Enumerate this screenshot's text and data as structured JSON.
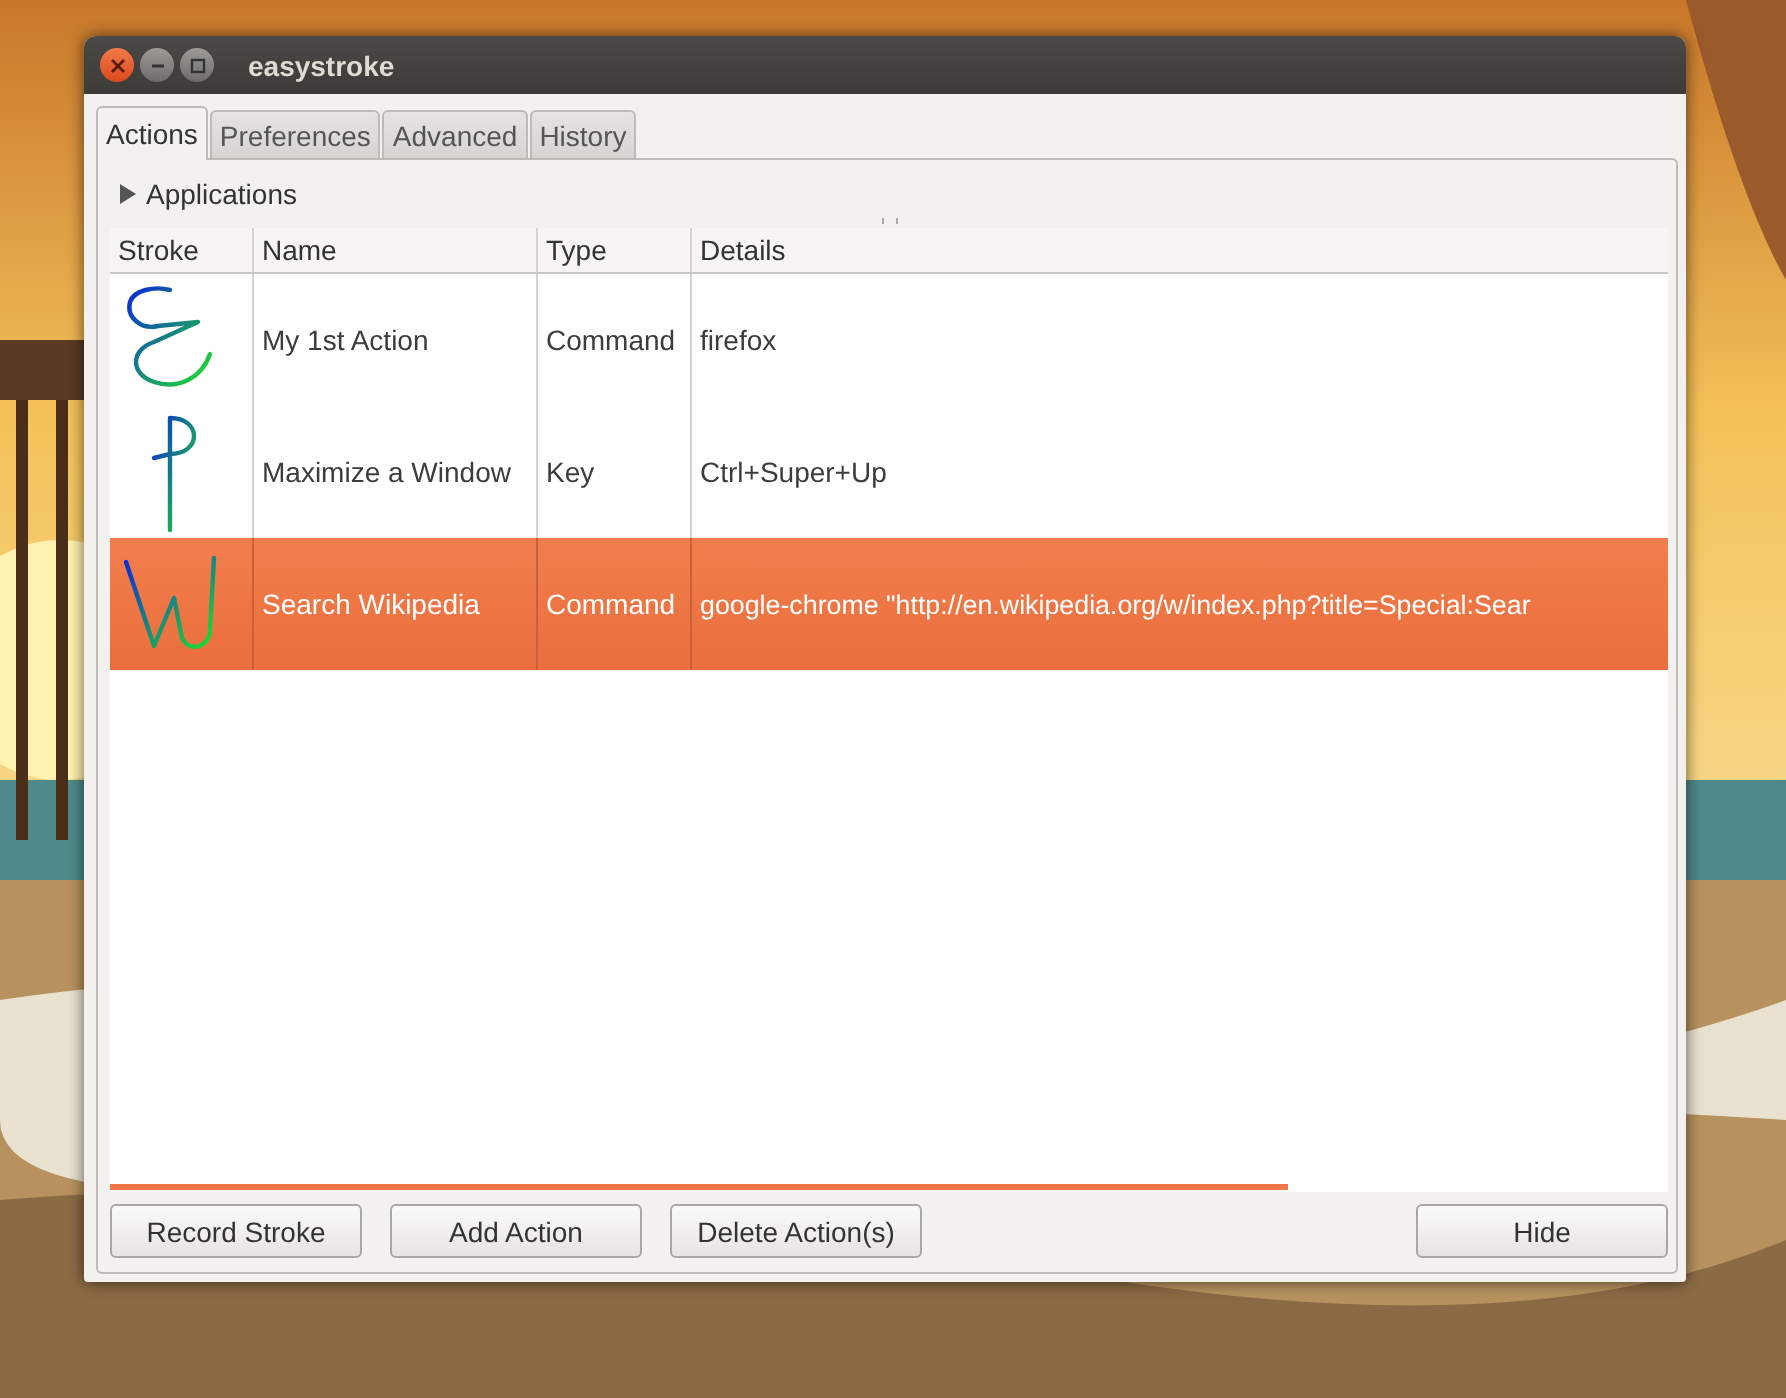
{
  "window": {
    "title": "easystroke"
  },
  "tabs": [
    {
      "label": "Actions",
      "selected": true
    },
    {
      "label": "Preferences",
      "selected": false
    },
    {
      "label": "Advanced",
      "selected": false
    },
    {
      "label": "History",
      "selected": false
    }
  ],
  "expander": {
    "label": "Applications",
    "expanded": false
  },
  "table": {
    "columns": [
      "Stroke",
      "Name",
      "Type",
      "Details"
    ],
    "rows": [
      {
        "name": "My 1st Action",
        "type": "Command",
        "details": "firefox",
        "selected": false
      },
      {
        "name": "Maximize a Window",
        "type": "Key",
        "details": "Ctrl+Super+Up",
        "selected": false
      },
      {
        "name": "Search Wikipedia",
        "type": "Command",
        "details": "google-chrome \"http://en.wikipedia.org/w/index.php?title=Special:Sear",
        "selected": true
      }
    ]
  },
  "buttons": [
    "Record Stroke",
    "Add Action",
    "Delete Action(s)"
  ],
  "hide_button": "Hide"
}
